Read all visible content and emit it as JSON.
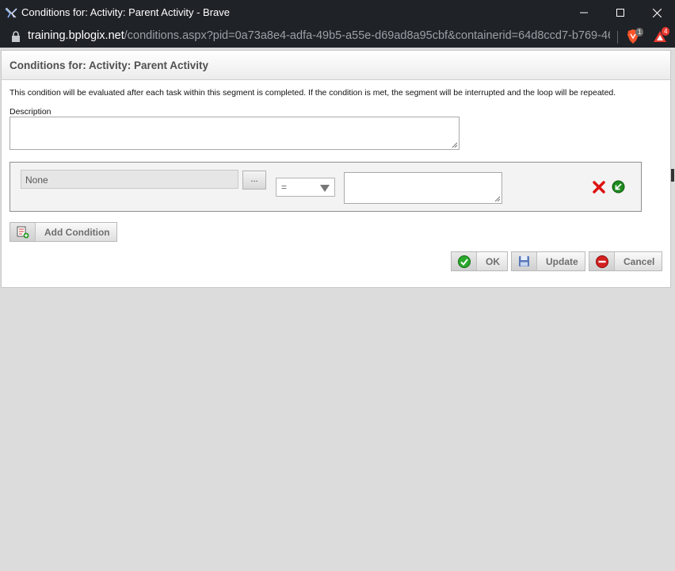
{
  "browser": {
    "window_title": "Conditions for: Activity: Parent Activity - Brave",
    "url_host": "training.bplogix.net",
    "url_path": "/conditions.aspx?pid=0a73a8e4-adfa-49b5-a55e-d69ad8a95cbf&containerid=64d8ccd7-b769-46...",
    "brave_badge": "1",
    "rewards_badge": "4"
  },
  "dialog": {
    "title": "Conditions for: Activity: Parent Activity",
    "info_text": "This condition will be evaluated after each task within this segment is completed. If the condition is met, the segment will be interrupted and the loop will be repeated.",
    "description_label": "Description",
    "description_value": ""
  },
  "condition": {
    "field_value": "None",
    "more_label": "...",
    "operator_value": "=",
    "value_text": ""
  },
  "actions": {
    "add_condition_label": "Add Condition",
    "ok_label": "OK",
    "update_label": "Update",
    "cancel_label": "Cancel"
  },
  "icons": {
    "ok": "check-icon",
    "update": "save-icon",
    "cancel": "cancel-icon",
    "delete": "delete-x-icon",
    "insert": "insert-arrow-icon",
    "add_condition": "add-condition-icon"
  }
}
